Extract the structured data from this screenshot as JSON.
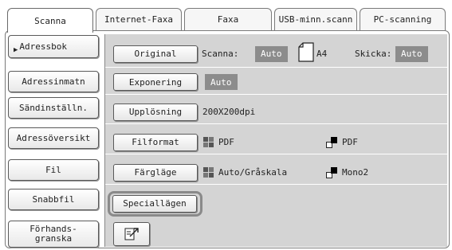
{
  "tabs": [
    {
      "label": "Scanna",
      "active": true
    },
    {
      "label": "Internet-Faxa",
      "active": false
    },
    {
      "label": "Faxa",
      "active": false
    },
    {
      "label": "USB-minn.scann",
      "active": false
    },
    {
      "label": "PC-scanning",
      "active": false
    }
  ],
  "sidebar": {
    "items": [
      {
        "label": "Adressbok",
        "marker": "▶"
      },
      {
        "label": "Adressinmatn"
      },
      {
        "label": "Sändinställn."
      },
      {
        "label": "Adressöversikt"
      },
      {
        "label": "Fil"
      },
      {
        "label": "Snabbfil"
      },
      {
        "label_line1": "Förhands-",
        "label_line2": "granska"
      }
    ]
  },
  "settings": {
    "original": {
      "button": "Original",
      "scan_label": "Scanna:",
      "scan_value": "Auto",
      "paper": "A4",
      "send_label": "Skicka:",
      "send_value": "Auto"
    },
    "exposure": {
      "button": "Exponering",
      "value": "Auto"
    },
    "resolution": {
      "button": "Upplösning",
      "value": "200X200dpi"
    },
    "file_format": {
      "button": "Filformat",
      "color_value": "PDF",
      "mono_value": "PDF"
    },
    "color_mode": {
      "button": "Färgläge",
      "color_value": "Auto/Gråskala",
      "mono_value": "Mono2"
    },
    "special": {
      "button": "Speciallägen"
    }
  },
  "icons": {
    "paper": "paper-a4-icon",
    "color": "color-squares-icon",
    "mono": "mono-icon",
    "preview": "document-export-icon"
  },
  "colors": {
    "panel_bg": "#d4d4d4",
    "badge_bg": "#8c8c8c",
    "border": "#7a7a7a"
  }
}
